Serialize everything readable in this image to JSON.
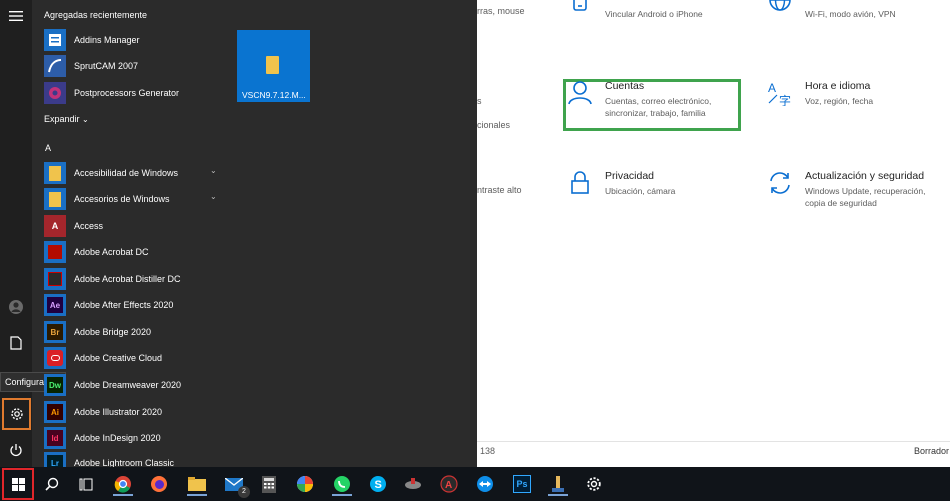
{
  "settings": {
    "partials": [
      "rras, mouse",
      "s",
      "cionales",
      "ntraste alto",
      "138"
    ],
    "items": [
      {
        "title": "",
        "desc": "Vincular Android o iPhone",
        "icon": "phone-icon"
      },
      {
        "title": "",
        "desc": "Wi-Fi, modo avión, VPN",
        "icon": "globe-icon"
      },
      {
        "title": "Cuentas",
        "desc_lines": [
          "Cuentas, correo electrónico,",
          "sincronizar, trabajo, familia"
        ],
        "icon": "person-icon"
      },
      {
        "title": "Hora e idioma",
        "desc": "Voz, región, fecha",
        "icon": "time-language-icon"
      },
      {
        "title": "Privacidad",
        "desc": "Ubicación, cámara",
        "icon": "lock-icon"
      },
      {
        "title": "Actualización y seguridad",
        "desc_lines": [
          "Windows Update, recuperación,",
          "copia de seguridad"
        ],
        "icon": "update-icon"
      }
    ],
    "bottom_right": "Borrador",
    "highlight_color": "#3fa34d"
  },
  "start_menu": {
    "recent_header": "Agregadas recientemente",
    "recent": [
      {
        "label": "Addins Manager",
        "icon": "addins-icon"
      },
      {
        "label": "SprutCAM 2007",
        "icon": "sprutcam-icon"
      },
      {
        "label": "Postprocessors Generator",
        "icon": "postprocessor-icon"
      }
    ],
    "expand_label": "Expandir",
    "letter": "A",
    "apps": [
      {
        "label": "Accesibilidad de Windows",
        "icon": "folder-icon",
        "chevron": true
      },
      {
        "label": "Accesorios de Windows",
        "icon": "folder-icon",
        "chevron": true
      },
      {
        "label": "Access",
        "icon": "access-icon"
      },
      {
        "label": "Adobe Acrobat DC",
        "icon": "acrobat-icon"
      },
      {
        "label": "Adobe Acrobat Distiller DC",
        "icon": "distiller-icon"
      },
      {
        "label": "Adobe After Effects 2020",
        "icon": "after-effects-icon",
        "abbr": "Ae"
      },
      {
        "label": "Adobe Bridge 2020",
        "icon": "bridge-icon",
        "abbr": "Br"
      },
      {
        "label": "Adobe Creative Cloud",
        "icon": "creative-cloud-icon"
      },
      {
        "label": "Adobe Dreamweaver 2020",
        "icon": "dreamweaver-icon",
        "abbr": "Dw"
      },
      {
        "label": "Adobe Illustrator 2020",
        "icon": "illustrator-icon",
        "abbr": "Ai"
      },
      {
        "label": "Adobe InDesign 2020",
        "icon": "indesign-icon",
        "abbr": "Id"
      },
      {
        "label": "Adobe Lightroom Classic",
        "icon": "lightroom-icon",
        "abbr": "Lr"
      }
    ],
    "tile_label": "VSCN9.7.12.M...",
    "tooltip": "Configuración"
  },
  "taskbar": {
    "mail_badge": "2",
    "ps_abbr": "Ps"
  }
}
